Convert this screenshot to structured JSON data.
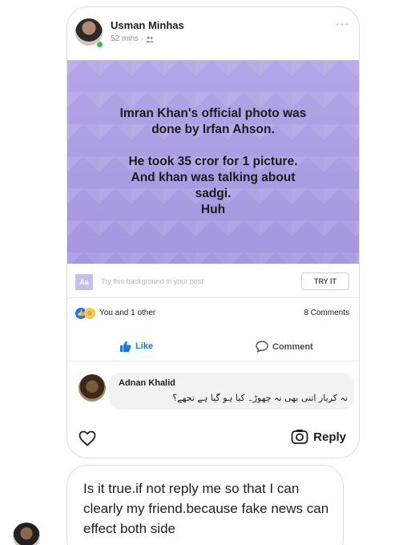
{
  "post": {
    "author": "Usman Minhas",
    "time": "52 mins",
    "separator": "·",
    "more": "···",
    "bg_lines_1": [
      "Imran Khan's official photo was",
      "done by Irfan Ahson."
    ],
    "bg_lines_2": [
      "He took 35 cror for 1 picture.",
      "And khan was talking about",
      "sadgi.",
      "Huh"
    ],
    "bg_color": "#a99ae2",
    "try_icon": "Aa",
    "try_text": "Try this background in your post",
    "try_button": "TRY IT",
    "reactions_text": "You and 1 other",
    "comments_count": "8 Comments",
    "like_label": "Like",
    "comment_label": "Comment",
    "comment": {
      "name": "Adnan Khalid",
      "text": "نہ کریار اتنی بھی نہ چھوڑ۔ کیا ہو گیا ہے تجھے؟"
    }
  },
  "footer": {
    "reply_label": "Reply"
  },
  "message2": {
    "text": "Is it true.if not reply me so that I can clearly my friend.because fake news can effect both side"
  },
  "colors": {
    "facebook_blue": "#1877f2",
    "online_green": "#31c24d"
  },
  "icons": [
    "friends-icon",
    "more-icon",
    "like-thumb-icon",
    "comment-icon",
    "heart-icon",
    "camera-reply-icon"
  ]
}
